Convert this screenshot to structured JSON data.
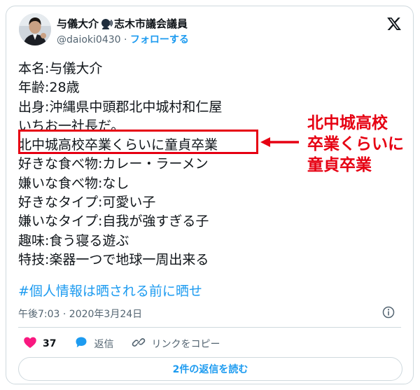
{
  "tweet": {
    "display_name": "与儀大介",
    "title_suffix": "志木市議会議員",
    "handle": "@daioki0430",
    "separator": "·",
    "follow_label": "フォローする",
    "icons": {
      "speaker": "speaking-head-icon",
      "platform": "x-logo-icon",
      "info": "info-icon",
      "like": "heart-icon",
      "reply": "reply-bubble-icon",
      "copy_link": "link-icon"
    },
    "body_lines": [
      "本名:与儀大介",
      "年齢:28歳",
      "出身:沖縄県中頭郡北中城村和仁屋",
      "いちお一社長だ。",
      "北中城高校卒業くらいに童貞卒業",
      "好きな食べ物:カレー・ラーメン",
      "嫌いな食べ物:なし",
      "好きなタイプ:可愛い子",
      "嫌いなタイプ:自我が強すぎる子",
      "趣味:食う寝る遊ぶ",
      "特技:楽器一つで地球一周出来る"
    ],
    "hashtag": "#個人情報は晒される前に晒せ",
    "timestamp": "午後7:03 · 2020年3月24日",
    "like_count": "37",
    "reply_label": "返信",
    "copy_link_label": "リンクをコピー",
    "read_replies_label": "2件の返信を読む"
  },
  "annotation": {
    "lines": [
      "北中城高校",
      "卒業くらいに",
      "童貞卒業"
    ],
    "highlighted_line_index": 4
  },
  "colors": {
    "accent_blue": "#1d9bf0",
    "annotation_red": "#e60012",
    "like_pink": "#f91880",
    "secondary_text": "#536471"
  }
}
